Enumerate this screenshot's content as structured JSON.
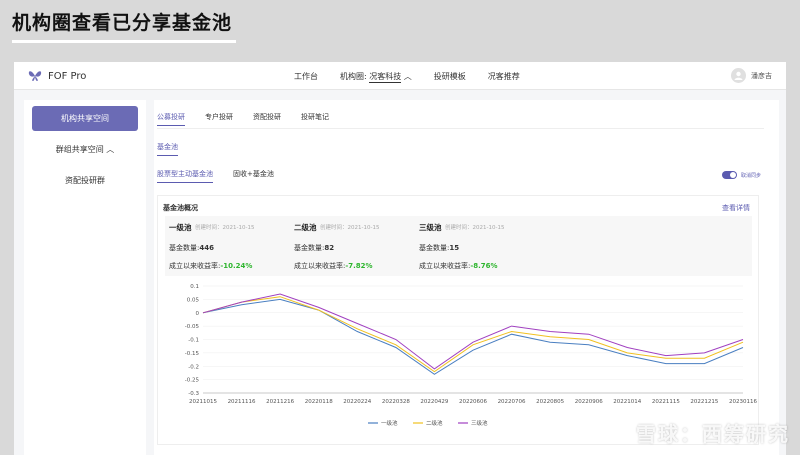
{
  "slide": {
    "title": "机构圈查看已分享基金池"
  },
  "app": {
    "logo_text": "FOF Pro",
    "nav": {
      "workbench": "工作台",
      "circle_prefix": "机构圈:",
      "circle_name": "况客科技",
      "research_template": "投研模板",
      "recommend": "况客推荐"
    },
    "user": {
      "name": "潘彦吉"
    }
  },
  "sidebar": {
    "items": [
      "机构共享空间",
      "群组共享空间",
      "资配投研群"
    ]
  },
  "tabs": [
    "公募投研",
    "专户投研",
    "资配投研",
    "投研笔记"
  ],
  "subtab": "基金池",
  "pool_tabs": [
    "股票型主动基金池",
    "固收+基金池"
  ],
  "sync_label": "取消同步",
  "overview": {
    "title": "基金池概况",
    "details_link": "查看详情",
    "pools": [
      {
        "name": "一级池",
        "date": "创建时间：2021-10-15",
        "count_label": "基金数量:",
        "count": "446",
        "return_label": "成立以来收益率:",
        "return": "-10.24%"
      },
      {
        "name": "二级池",
        "date": "创建时间：2021-10-15",
        "count_label": "基金数量:",
        "count": "82",
        "return_label": "成立以来收益率:",
        "return": "-7.82%"
      },
      {
        "name": "三级池",
        "date": "创建时间：2021-10-15",
        "count_label": "基金数量:",
        "count": "15",
        "return_label": "成立以来收益率:",
        "return": "-8.76%"
      }
    ]
  },
  "watermark": "雪球：西筹研究",
  "colors": {
    "accent": "#5b5bb0",
    "series1": "#4a7fc1",
    "series2": "#f0c020",
    "series3": "#a040c0",
    "positive": "#2db52d"
  },
  "chart_data": {
    "type": "line",
    "x": [
      "20211015",
      "20211116",
      "20211216",
      "20220118",
      "20220224",
      "20220328",
      "20220429",
      "20220606",
      "20220706",
      "20220805",
      "20220906",
      "20221014",
      "20221115",
      "20221215",
      "20230116"
    ],
    "ylim": [
      -0.3,
      0.1
    ],
    "yticks": [
      "0.1",
      "0.05",
      "0",
      "-0.05",
      "-0.1",
      "-0.15",
      "-0.2",
      "-0.25",
      "-0.3"
    ],
    "series": [
      {
        "name": "一级池",
        "color": "#4a7fc1",
        "values": [
          0.0,
          0.03,
          0.05,
          0.01,
          -0.07,
          -0.13,
          -0.23,
          -0.14,
          -0.08,
          -0.11,
          -0.12,
          -0.16,
          -0.19,
          -0.19,
          -0.13
        ]
      },
      {
        "name": "二级池",
        "color": "#f0c020",
        "values": [
          0.0,
          0.04,
          0.06,
          0.01,
          -0.06,
          -0.12,
          -0.22,
          -0.12,
          -0.07,
          -0.09,
          -0.1,
          -0.15,
          -0.17,
          -0.17,
          -0.11
        ]
      },
      {
        "name": "三级池",
        "color": "#a040c0",
        "values": [
          0.0,
          0.04,
          0.07,
          0.02,
          -0.04,
          -0.1,
          -0.21,
          -0.11,
          -0.05,
          -0.07,
          -0.08,
          -0.13,
          -0.16,
          -0.15,
          -0.1
        ]
      }
    ]
  }
}
